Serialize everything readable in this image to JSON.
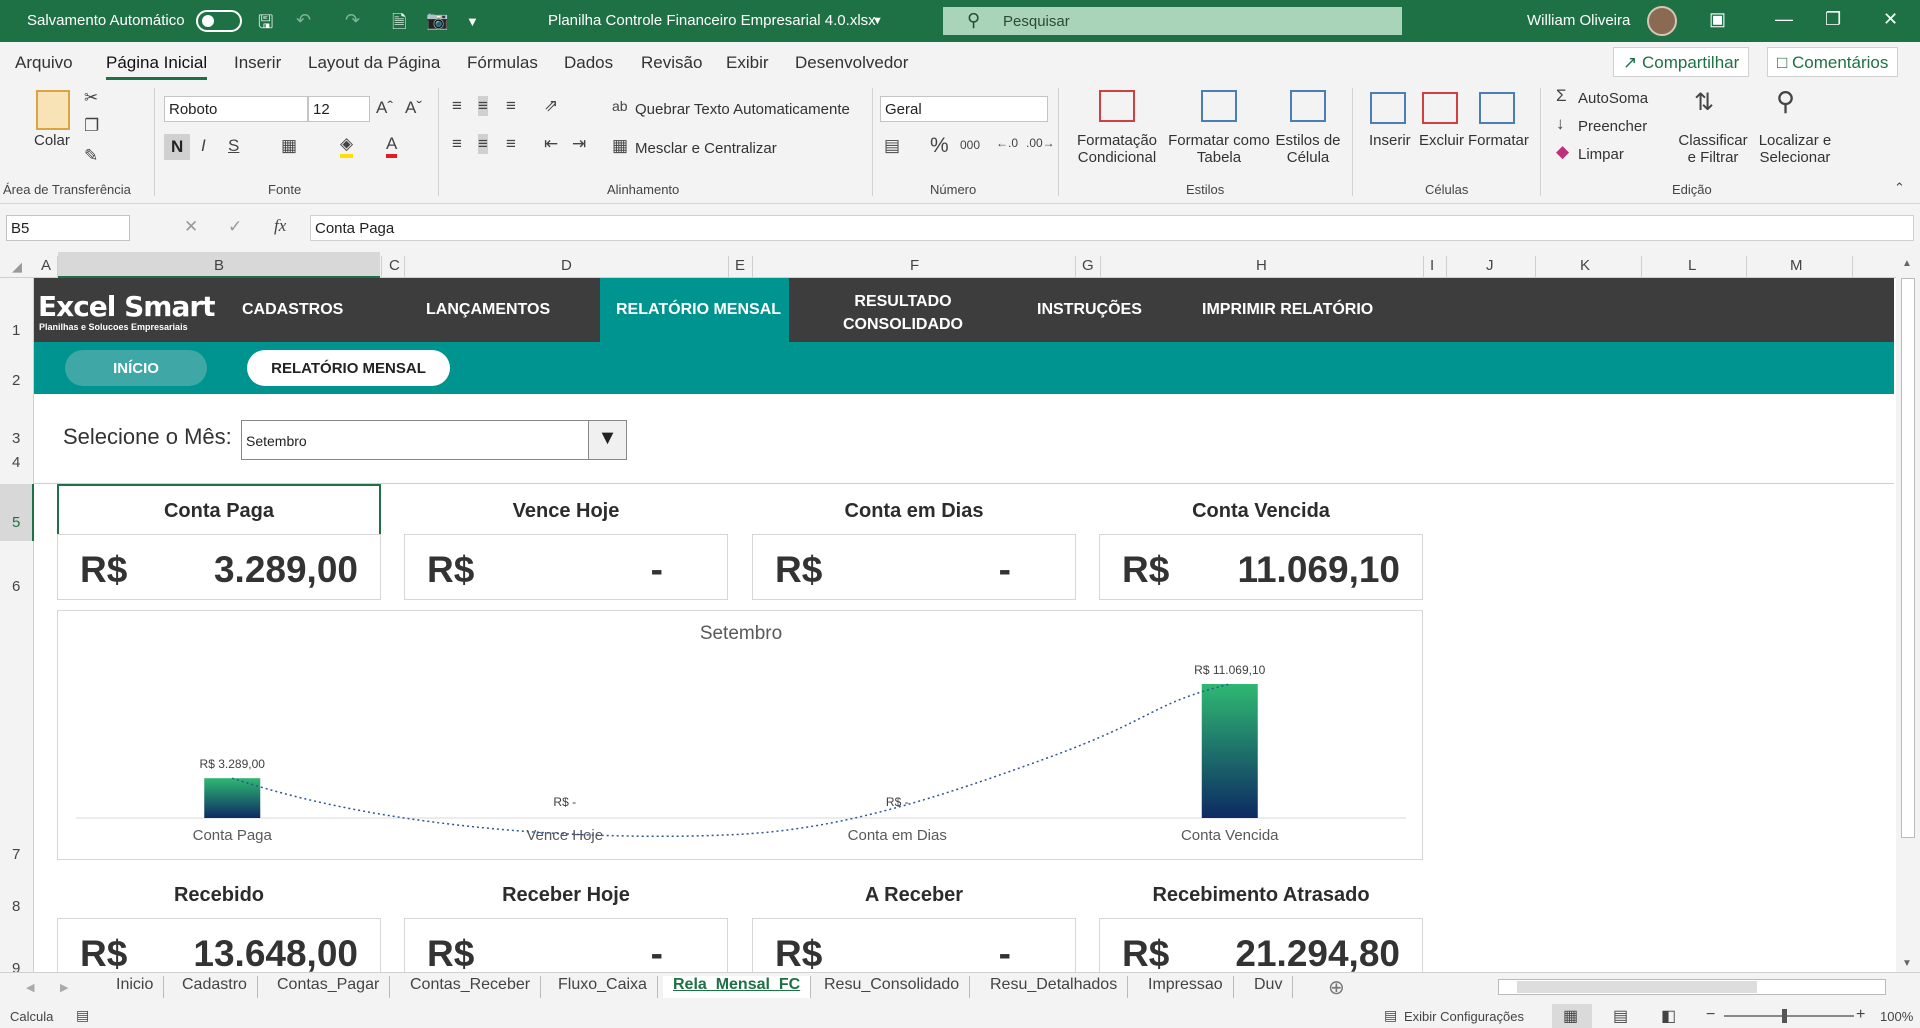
{
  "titlebar": {
    "autosave_label": "Salvamento Automático",
    "filename": "Planilha Controle Financeiro Empresarial 4.0.xlsx",
    "search_placeholder": "Pesquisar",
    "user_name": "William Oliveira",
    "bg_color": "#1e7145"
  },
  "menu": {
    "items": [
      "Arquivo",
      "Página Inicial",
      "Inserir",
      "Layout da Página",
      "Fórmulas",
      "Dados",
      "Revisão",
      "Exibir",
      "Desenvolvedor"
    ],
    "active": "Página Inicial",
    "share_label": "Compartilhar",
    "comments_label": "Comentários"
  },
  "ribbon": {
    "clipboard": {
      "paste_label": "Colar",
      "group": "Área de Transferência"
    },
    "font": {
      "name": "Roboto",
      "size": "12",
      "bold": "N",
      "italic": "I",
      "underline": "S",
      "group": "Fonte"
    },
    "alignment": {
      "wrap": "Quebrar Texto Automaticamente",
      "merge": "Mesclar e Centralizar",
      "group": "Alinhamento"
    },
    "number": {
      "format": "Geral",
      "percent": "%",
      "thousands": "000",
      "group": "Número"
    },
    "styles": {
      "conditional": "Formatação Condicional",
      "table": "Formatar como Tabela",
      "cell": "Estilos de Célula",
      "group": "Estilos"
    },
    "cells": {
      "insert": "Inserir",
      "delete": "Excluir",
      "format": "Formatar",
      "group": "Células"
    },
    "editing": {
      "autosum": "AutoSoma",
      "fill": "Preencher",
      "clear": "Limpar",
      "sort": "Classificar e Filtrar",
      "find": "Localizar e Selecionar",
      "group": "Edição"
    }
  },
  "formula_bar": {
    "name_box": "B5",
    "fx": "fx",
    "content": "Conta Paga"
  },
  "columns": [
    "A",
    "B",
    "C",
    "D",
    "E",
    "F",
    "G",
    "H",
    "I",
    "J",
    "K",
    "L",
    "M"
  ],
  "rows": [
    "1",
    "2",
    "3",
    "4",
    "5",
    "6",
    "7",
    "8",
    "9"
  ],
  "sheet": {
    "logo_title": "Excel Smart",
    "logo_subtitle": "Planilhas e Solucoes Empresariais",
    "nav": [
      "CADASTROS",
      "LANÇAMENTOS",
      "RELATÓRIO MENSAL",
      "RESULTADO CONSOLIDADO",
      "INSTRUÇÕES",
      "IMPRIMIR RELATÓRIO"
    ],
    "nav_active": "RELATÓRIO MENSAL",
    "nav_bg": "#3d3d3d",
    "accent": "#009490",
    "subnav": {
      "home": "INÍCIO",
      "current": "RELATÓRIO MENSAL"
    },
    "month_label": "Selecione o Mês:",
    "month_value": "Setembro",
    "cards_top": [
      {
        "title": "Conta Paga",
        "currency": "R$",
        "value": "3.289,00"
      },
      {
        "title": "Vence Hoje",
        "currency": "R$",
        "value": "-"
      },
      {
        "title": "Conta em Dias",
        "currency": "R$",
        "value": "-"
      },
      {
        "title": "Conta Vencida",
        "currency": "R$",
        "value": "11.069,10"
      }
    ],
    "cards_bottom": [
      {
        "title": "Recebido",
        "currency": "R$",
        "value": "13.648,00"
      },
      {
        "title": "Receber Hoje",
        "currency": "R$",
        "value": "-"
      },
      {
        "title": "A Receber",
        "currency": "R$",
        "value": "-"
      },
      {
        "title": "Recebimento Atrasado",
        "currency": "R$",
        "value": "21.294,80"
      }
    ]
  },
  "chart_data": {
    "type": "bar",
    "title": "Setembro",
    "categories": [
      "Conta Paga",
      "Vence Hoje",
      "Conta em Dias",
      "Conta Vencida"
    ],
    "values": [
      3289.0,
      0,
      0,
      11069.1
    ],
    "data_labels": [
      "R$ 3.289,00",
      "R$ -",
      "R$ -",
      "R$ 11.069,10"
    ],
    "trendline": "dotted",
    "bar_gradient": [
      "#2fb872",
      "#0d2a63"
    ],
    "grid": false
  },
  "tabs": [
    "Inicio",
    "Cadastro",
    "Contas_Pagar",
    "Contas_Receber",
    "Fluxo_Caixa",
    "Rela_Mensal_FC",
    "Resu_Consolidado",
    "Resu_Detalhados",
    "Impressao",
    "Duv"
  ],
  "active_tab": "Rela_Mensal_FC",
  "status": {
    "mode": "Calcula",
    "display_settings": "Exibir Configurações",
    "zoom": "100%"
  }
}
